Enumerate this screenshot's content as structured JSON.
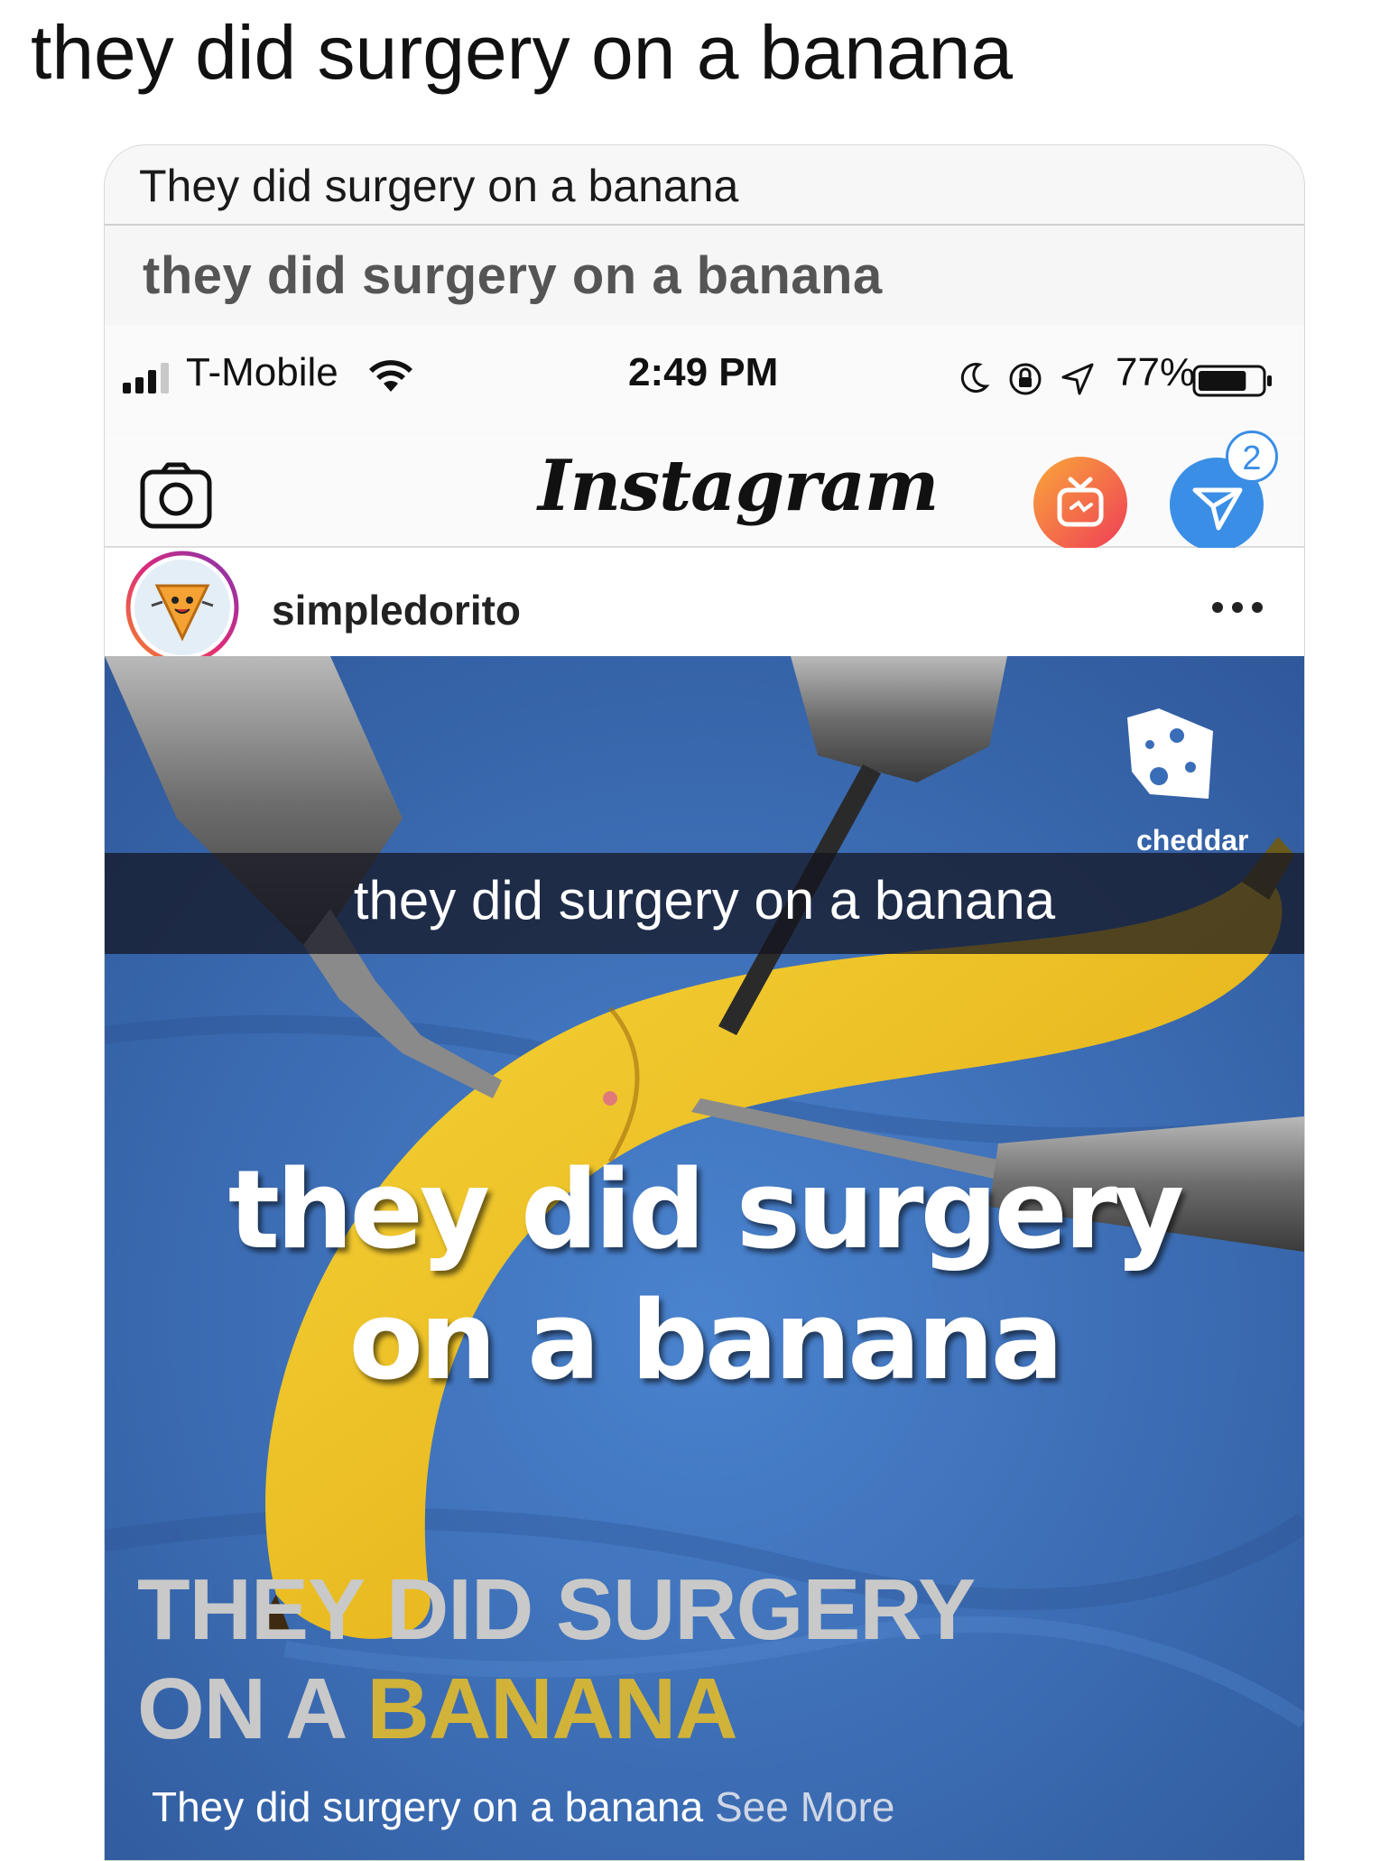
{
  "tweet": {
    "text": "they did surgery on a banana"
  },
  "notification": {
    "title": "They did surgery on a banana"
  },
  "search": {
    "text": "they did surgery on a banana"
  },
  "status_bar": {
    "carrier": "T-Mobile",
    "time": "2:49 PM",
    "battery_percent": "77%",
    "battery_level": 0.77
  },
  "instagram": {
    "logo": "Instagram",
    "dm_badge_count": "2",
    "icons": [
      "camera-icon",
      "igtv-icon",
      "direct-message-icon"
    ]
  },
  "post": {
    "username": "simpledorito",
    "watermark": "cheddar",
    "snap_caption": "they did surgery on a banana",
    "big_caption_line1": "they did surgery",
    "big_caption_line2": "on a banana",
    "caps_caption_line1": "THEY DID SURGERY",
    "caps_caption_line2_a": "ON A ",
    "caps_caption_line2_b": "BANANA",
    "bottom_caption": "They did surgery on a banana",
    "see_more": "See More"
  },
  "colors": {
    "instagram_dm_blue": "#3a8ee6",
    "igtv_orange": "#f5842a",
    "caps_banana_gold": "#d1b33a"
  }
}
